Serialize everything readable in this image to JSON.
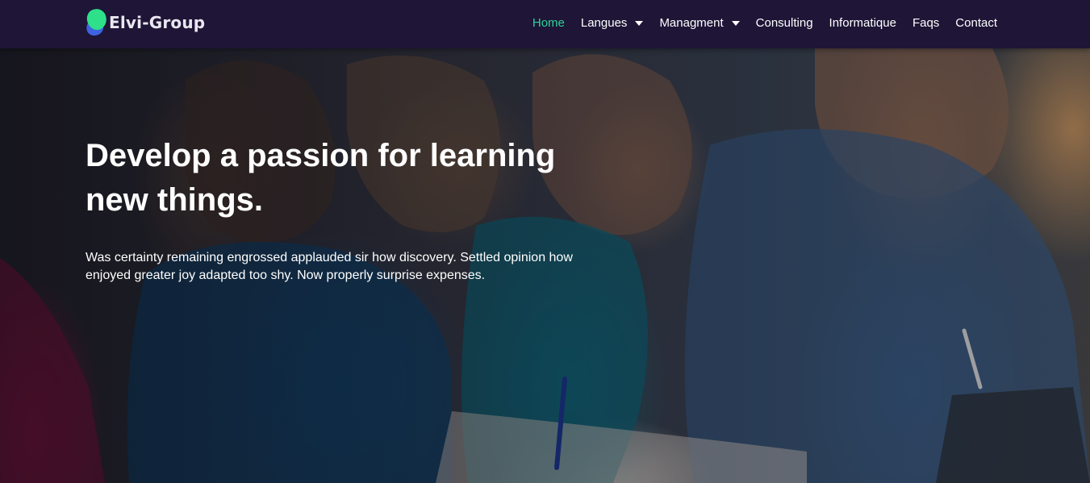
{
  "brand": {
    "name": "Elvi-Group"
  },
  "nav": {
    "items": [
      {
        "label": "Home",
        "active": true,
        "dropdown": false
      },
      {
        "label": "Langues",
        "active": false,
        "dropdown": true
      },
      {
        "label": "Managment",
        "active": false,
        "dropdown": true
      },
      {
        "label": "Consulting",
        "active": false,
        "dropdown": false
      },
      {
        "label": "Informatique",
        "active": false,
        "dropdown": false
      },
      {
        "label": "Faqs",
        "active": false,
        "dropdown": false
      },
      {
        "label": "Contact",
        "active": false,
        "dropdown": false
      }
    ]
  },
  "hero": {
    "title": "Develop a passion for learning new things.",
    "text": "Was certainty remaining engrossed applauded sir how discovery. Settled opinion how enjoyed greater joy adapted too shy. Now properly surprise expenses.",
    "image": "students-studying-photo"
  },
  "colors": {
    "navbar_bg": "#1e1537",
    "active_link": "#2ed39a",
    "logo_green": "#2fe08a",
    "logo_blue": "#3d63e0"
  },
  "icons": {
    "dropdown": "caret-down-icon"
  }
}
